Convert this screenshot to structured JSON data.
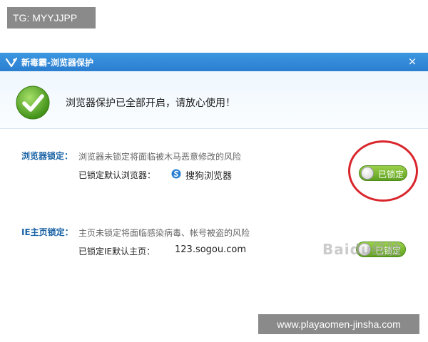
{
  "overlay": {
    "tag": "TG: MYYJJPP",
    "url": "www.playaomen-jinsha.com"
  },
  "window": {
    "title": "新毒霸-浏览器保护",
    "close_label": "×"
  },
  "banner": {
    "message": "浏览器保护已全部开启，请放心使用！"
  },
  "browser_lock": {
    "label": "浏览器锁定：",
    "description": "浏览器未锁定将面临被木马恶意修改的风险",
    "sub_label": "已锁定默认浏览器：",
    "value": "搜狗浏览器",
    "toggle_label": "已锁定"
  },
  "homepage_lock": {
    "label": "IE主页锁定：",
    "description": "主页未锁定将面临感染病毒、帐号被盗的风险",
    "sub_label": "已锁定IE默认主页：",
    "value": "123.sogou.com",
    "toggle_label": "已锁定"
  },
  "watermark": "Baidu经验",
  "colors": {
    "titlebar": "#2a7ed0",
    "toggle_on": "#6fb12a",
    "highlight_circle": "#d9262c"
  }
}
